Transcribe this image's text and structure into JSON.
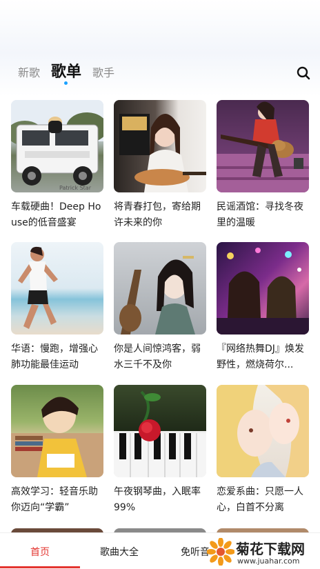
{
  "tabs": [
    {
      "label": "新歌"
    },
    {
      "label": "歌单"
    },
    {
      "label": "歌手"
    }
  ],
  "playlists": [
    {
      "title": "车载硬曲！Deep House的低音盛宴"
    },
    {
      "title": "将青春打包，寄给期许未来的你"
    },
    {
      "title": "民谣酒馆：寻找冬夜里的温暖"
    },
    {
      "title": "华语：慢跑，增强心肺功能最佳运动"
    },
    {
      "title": "你是人间惊鸿客，弱水三千不及你"
    },
    {
      "title": "『网络热舞DJ』焕发野性，燃烧荷尔..."
    },
    {
      "title": "高效学习：轻音乐助你迈向“学霸”"
    },
    {
      "title": "午夜钢琴曲，入眠率99%"
    },
    {
      "title": "恋爱系曲：只愿一人心，白首不分离"
    }
  ],
  "thumb_text": {
    "car_plate": "Patrick Star"
  },
  "bottom_nav": [
    {
      "label": "首页"
    },
    {
      "label": "歌曲大全"
    },
    {
      "label": "免听音"
    }
  ],
  "watermark": {
    "title": "菊花下载网",
    "url": "www.juahar.com"
  },
  "colors": {
    "accent": "#e3342f",
    "tab_dot": "#1aa1ff"
  }
}
